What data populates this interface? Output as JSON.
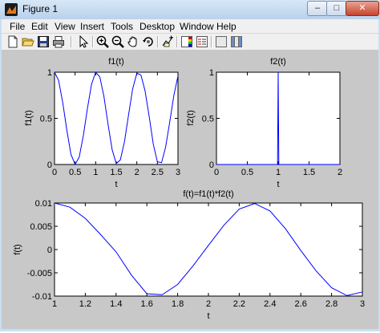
{
  "window": {
    "title": "Figure 1",
    "minimize_glyph": "–",
    "maximize_glyph": "□",
    "close_glyph": "✕"
  },
  "menu": [
    "File",
    "Edit",
    "View",
    "Insert",
    "Tools",
    "Desktop",
    "Window",
    "Help"
  ],
  "toolbar": {
    "icons": [
      "new-figure-icon",
      "open-file-icon",
      "save-figure-icon",
      "print-figure-icon",
      "edit-plot-arrow-icon",
      "zoom-in-icon",
      "zoom-out-icon",
      "pan-hand-icon",
      "rotate-3d-icon",
      "data-cursor-icon",
      "colorbar-icon",
      "legend-icon",
      "hide-plot-tools-icon",
      "show-plot-tools-icon"
    ]
  },
  "chart_data": [
    {
      "type": "line",
      "title": "f1(t)",
      "xlabel": "t",
      "ylabel": "f1(t)",
      "xlim": [
        0,
        3
      ],
      "ylim": [
        0,
        1
      ],
      "xticks": [
        "0",
        "0.5",
        "1",
        "1.5",
        "2",
        "2.5",
        "3"
      ],
      "yticks": [
        "0",
        "0.5",
        "1"
      ],
      "color": "#0000ff",
      "series": [
        {
          "x": [
            0,
            0.1,
            0.2,
            0.3,
            0.4,
            0.5,
            0.6,
            0.7,
            0.8,
            0.9,
            1.0,
            1.1,
            1.2,
            1.3,
            1.4,
            1.5,
            1.6,
            1.7,
            1.8,
            1.9,
            2.0,
            2.1,
            2.2,
            2.3,
            2.4,
            2.5,
            2.6,
            2.7,
            2.8,
            2.9,
            3.0
          ],
          "values": [
            1.0,
            0.91,
            0.67,
            0.37,
            0.11,
            0.0,
            0.08,
            0.31,
            0.61,
            0.87,
            1.0,
            0.95,
            0.74,
            0.44,
            0.16,
            0.01,
            0.05,
            0.25,
            0.54,
            0.82,
            0.99,
            0.97,
            0.8,
            0.52,
            0.22,
            0.03,
            0.02,
            0.19,
            0.46,
            0.75,
            0.96
          ]
        }
      ]
    },
    {
      "type": "line",
      "title": "f2(t)",
      "xlabel": "t",
      "ylabel": "f2(t)",
      "xlim": [
        0,
        2
      ],
      "ylim": [
        0,
        1
      ],
      "xticks": [
        "0",
        "0.5",
        "1",
        "1.5",
        "2"
      ],
      "yticks": [
        "0",
        "0.5",
        "1"
      ],
      "color": "#0000ff",
      "series": [
        {
          "x": [
            0,
            0.99,
            1.0,
            1.01,
            2.0
          ],
          "values": [
            0,
            0,
            1,
            0,
            0
          ]
        }
      ]
    },
    {
      "type": "line",
      "title": "f(t)=f1(t)*f2(t)",
      "xlabel": "t",
      "ylabel": "f(t)",
      "xlim": [
        1,
        3
      ],
      "ylim": [
        -0.01,
        0.01
      ],
      "xticks": [
        "1",
        "1.2",
        "1.4",
        "1.6",
        "1.8",
        "2",
        "2.2",
        "2.4",
        "2.6",
        "2.8",
        "3"
      ],
      "yticks": [
        "0.01",
        "0.005",
        "0",
        "-0.005",
        "-0.01"
      ],
      "color": "#0000ff",
      "series": [
        {
          "x": [
            1.0,
            1.1,
            1.2,
            1.3,
            1.4,
            1.5,
            1.6,
            1.7,
            1.8,
            1.9,
            2.0,
            2.1,
            2.2,
            2.3,
            2.4,
            2.5,
            2.6,
            2.7,
            2.8,
            2.9,
            3.0
          ],
          "values": [
            0.01,
            0.0091,
            0.0067,
            0.0032,
            -0.0005,
            -0.0055,
            -0.0095,
            -0.0097,
            -0.0075,
            -0.0035,
            0.0009,
            0.0052,
            0.0087,
            0.0099,
            0.0083,
            0.0045,
            -0.0002,
            -0.0046,
            -0.0082,
            -0.0099,
            -0.0091
          ]
        }
      ]
    }
  ]
}
